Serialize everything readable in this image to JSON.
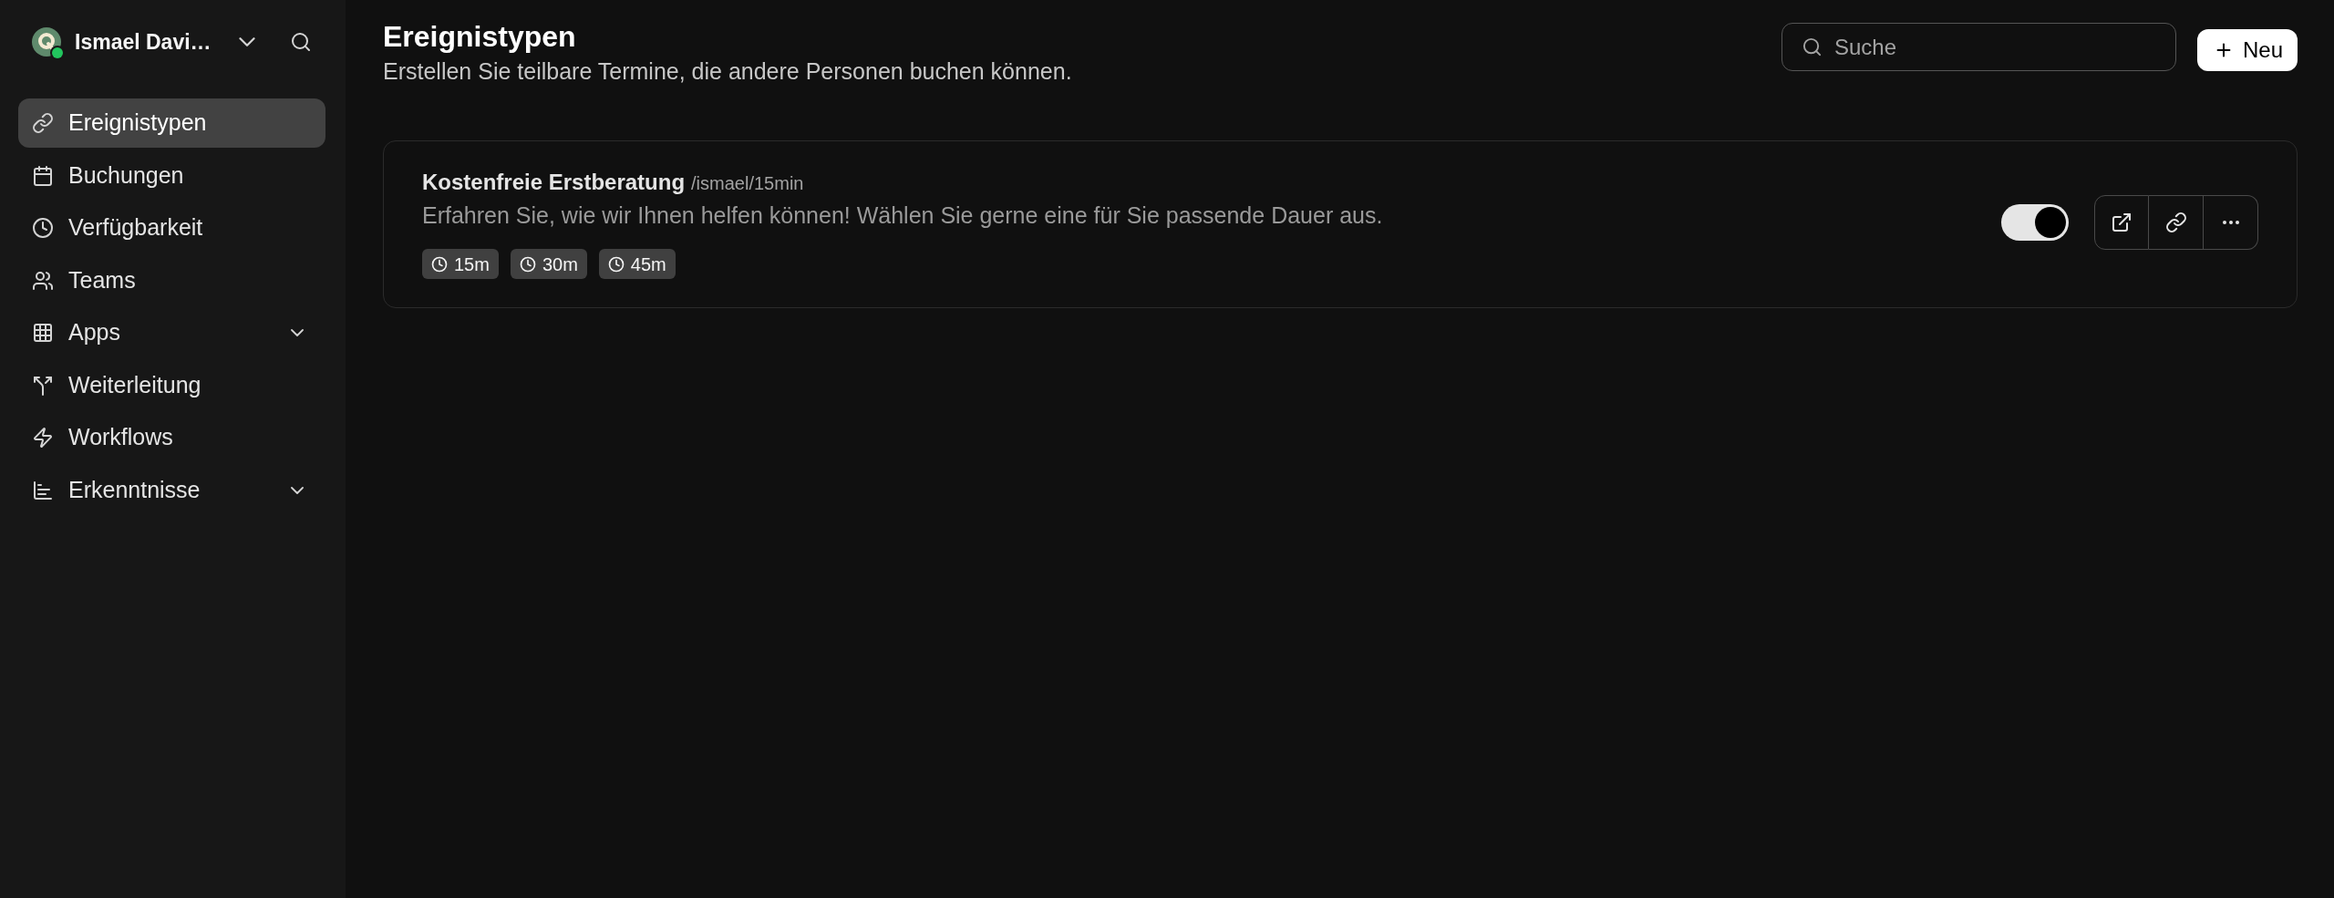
{
  "sidebar": {
    "user": {
      "name": "Ismael Davi…",
      "online": true
    },
    "items": [
      {
        "label": "Ereignistypen",
        "selected": true
      },
      {
        "label": "Buchungen",
        "selected": false
      },
      {
        "label": "Verfügbarkeit",
        "selected": false
      },
      {
        "label": "Teams",
        "selected": false
      },
      {
        "label": "Apps",
        "selected": false,
        "expanded": false
      },
      {
        "label": "Weiterleitung",
        "selected": false
      },
      {
        "label": "Workflows",
        "selected": false
      },
      {
        "label": "Erkenntnisse",
        "selected": false,
        "expanded": false
      }
    ]
  },
  "header": {
    "title": "Ereignistypen",
    "subtitle": "Erstellen Sie teilbare Termine, die andere Personen buchen können."
  },
  "search": {
    "placeholder": "Suche"
  },
  "new_button": {
    "label": "Neu"
  },
  "event_types": [
    {
      "title": "Kostenfreie Erstberatung",
      "slug": "/ismael/15min",
      "description": "Erfahren Sie, wie wir Ihnen helfen können! Wählen Sie gerne eine für Sie passende Dauer aus.",
      "durations": [
        "15m",
        "30m",
        "45m"
      ],
      "on": true
    }
  ]
}
